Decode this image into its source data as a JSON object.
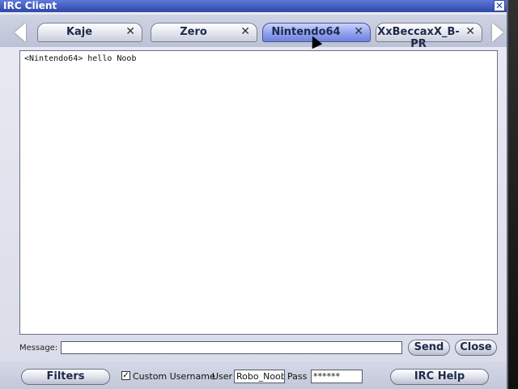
{
  "window": {
    "title": "IRC Client",
    "close_glyph": "✕"
  },
  "tabs": [
    {
      "label": "Kaje",
      "close": "✕",
      "active": false
    },
    {
      "label": "Zero",
      "close": "✕",
      "active": false
    },
    {
      "label": "Nintendo64",
      "close": "✕",
      "active": true
    },
    {
      "label": "XxBeccaxX_B-PR",
      "close": "✕",
      "active": false
    }
  ],
  "chat": {
    "lines": [
      "<Nintendo64> hello Noob"
    ]
  },
  "composer": {
    "message_label": "Message:",
    "message_value": "",
    "send_label": "Send",
    "close_label": "Close"
  },
  "footer": {
    "filters_label": "Filters",
    "custom_username_checked": true,
    "custom_username_label": "Custom Username",
    "user_label": "User",
    "user_value": "Robo_Noob",
    "pass_label": "Pass",
    "pass_value": "******",
    "irc_help_label": "IRC Help"
  },
  "colors": {
    "titlebar": "#2e47a8",
    "active_tab": "#8c9dec"
  }
}
